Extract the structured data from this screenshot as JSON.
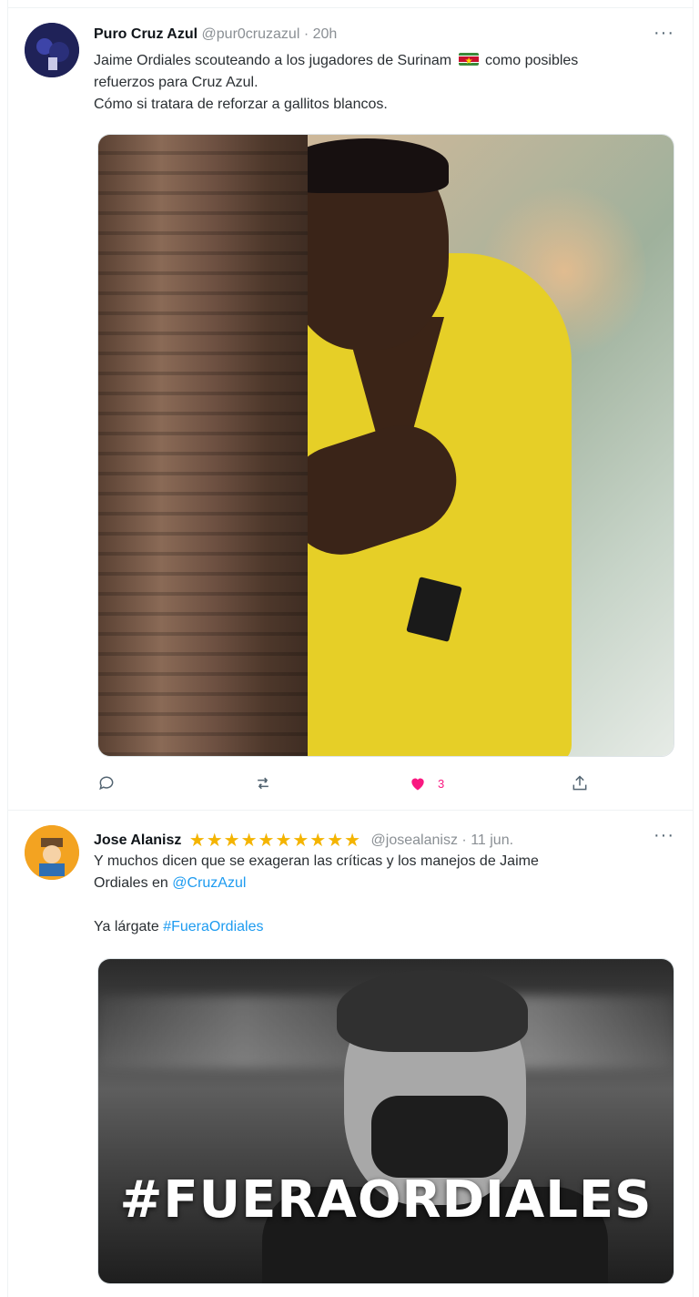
{
  "tweets": [
    {
      "author": {
        "name": "Puro Cruz Azul",
        "handle": "@pur0cruzazul",
        "time": "20h"
      },
      "text": {
        "line1_before_flag": "Jaime Ordiales scouteando a los jugadores de Surinam",
        "line1_after_flag": "como posibles",
        "line2": "refuerzos para Cruz Azul.",
        "line3": "Cómo si  tratara de reforzar a gallitos blancos."
      },
      "actions": {
        "likes": "3"
      }
    },
    {
      "author": {
        "name": "Jose Alanisz",
        "stars": "★★★★★★★★★★",
        "handle": "@josealanisz",
        "time": "11 jun."
      },
      "text": {
        "line1": "Y muchos dicen que se exageran las críticas y los manejos de Jaime",
        "line2_before": "Ordiales en ",
        "mention": "@CruzAzul",
        "line3_before": "Ya lárgate ",
        "hashtag": "#FueraOrdiales"
      },
      "media_text": "#FUERAORDIALES"
    }
  ],
  "ui": {
    "separator": "·",
    "more": "···"
  },
  "colors": {
    "link": "#1d9bf0",
    "like": "#f91880",
    "stars": "#f4b400"
  },
  "icons": [
    "reply-icon",
    "retweet-icon",
    "heart-icon",
    "share-icon",
    "more-icon",
    "flag-icon"
  ]
}
